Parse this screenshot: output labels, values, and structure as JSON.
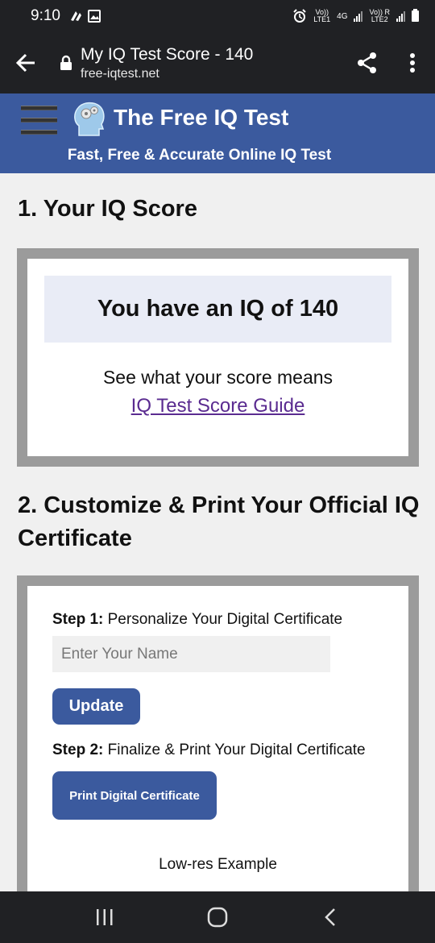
{
  "status_bar": {
    "time": "9:10",
    "net1_top": "Vo))",
    "net1_bottom": "LTE1",
    "net_type": "4G",
    "net2_top": "Vo)) R",
    "net2_bottom": "LTE2"
  },
  "browser": {
    "page_title": "My IQ Test Score - 140",
    "domain": "free-iqtest.net"
  },
  "site": {
    "name": "The Free IQ Test",
    "tagline": "Fast, Free & Accurate Online IQ Test"
  },
  "score_section": {
    "heading": "1. Your IQ Score",
    "score_text": "You have an IQ of 140",
    "see_text": "See what your score means",
    "guide_link": "IQ Test Score Guide"
  },
  "cert_section": {
    "heading": "2. Customize & Print Your Official IQ Certificate",
    "step1_label": "Step 1:",
    "step1_text": " Personalize Your Digital Certificate",
    "name_placeholder": "Enter Your Name",
    "update_button": "Update",
    "step2_label": "Step 2:",
    "step2_text": " Finalize & Print Your Digital Certificate",
    "print_button": "Print Digital Certificate",
    "example_caption": "Low-res Example"
  },
  "colors": {
    "brand_blue": "#3b5a9e",
    "link_purple": "#5a2b90",
    "dark_bar": "#202124"
  }
}
